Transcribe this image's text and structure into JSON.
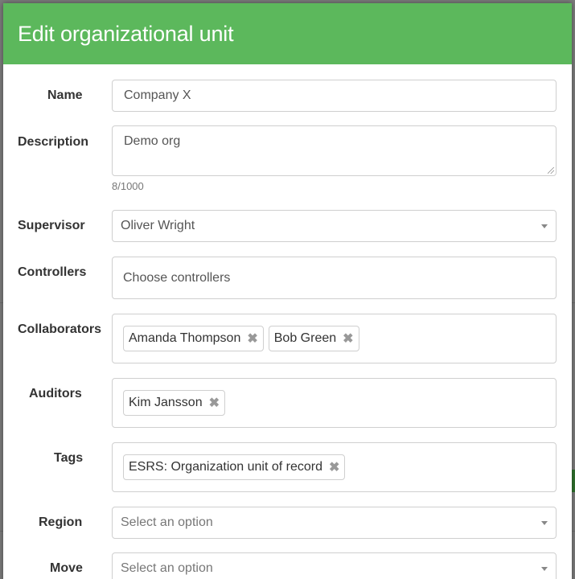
{
  "dialog": {
    "title": "Edit organizational unit"
  },
  "fields": {
    "name": {
      "label": "Name",
      "value": "Company X"
    },
    "description": {
      "label": "Description",
      "value": "Demo org",
      "counter": "8/1000"
    },
    "supervisor": {
      "label": "Supervisor",
      "value": "Oliver Wright"
    },
    "controllers": {
      "label": "Controllers",
      "placeholder": "Choose controllers"
    },
    "collaborators": {
      "label": "Collaborators",
      "tags": [
        "Amanda Thompson",
        "Bob Green"
      ]
    },
    "auditors": {
      "label": "Auditors",
      "tags": [
        "Kim Jansson"
      ]
    },
    "tags": {
      "label": "Tags",
      "tags": [
        "ESRS: Organization unit of record"
      ]
    },
    "region": {
      "label": "Region",
      "placeholder": "Select an option"
    },
    "move": {
      "label": "Move",
      "placeholder": "Select an option"
    }
  },
  "icons": {
    "remove": "✖"
  },
  "colors": {
    "header": "#5cb85c",
    "header_text": "#ffffff"
  }
}
